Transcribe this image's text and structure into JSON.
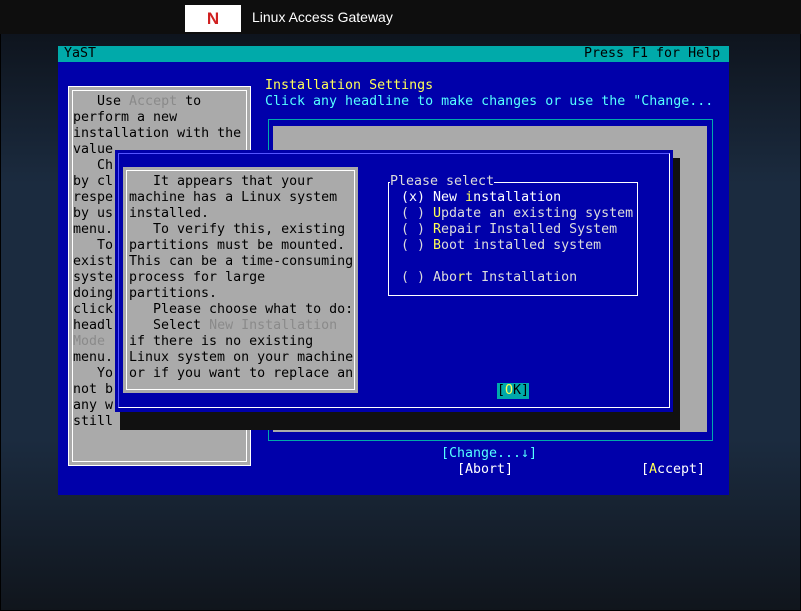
{
  "topbar": {
    "logo_letter": "N",
    "title": "Linux Access Gateway"
  },
  "yast": {
    "title": "YaST",
    "help_hint": "Press F1 for Help"
  },
  "main": {
    "heading": "Installation Settings",
    "subheading": "Click any headline to make changes or use the \"Change..."
  },
  "help": {
    "lines": [
      [
        "   Use ",
        "Accept",
        " to"
      ],
      [
        "perform a new",
        "",
        ""
      ],
      [
        "installation with the",
        "",
        ""
      ],
      [
        "value",
        "",
        ""
      ],
      [
        "   Ch",
        "",
        ""
      ],
      [
        "by cl",
        "",
        ""
      ],
      [
        "respe",
        "",
        ""
      ],
      [
        "by us",
        "",
        ""
      ],
      [
        "menu.",
        "",
        ""
      ],
      [
        "   To",
        "",
        ""
      ],
      [
        "exist",
        "",
        ""
      ],
      [
        "syste",
        "",
        ""
      ],
      [
        "doing",
        "",
        ""
      ],
      [
        "click",
        "",
        ""
      ],
      [
        "headl",
        "",
        ""
      ],
      [
        "",
        "Mode",
        ""
      ],
      [
        "menu.",
        "",
        ""
      ],
      [
        "   Yo",
        "",
        ""
      ],
      [
        "not b",
        "",
        ""
      ],
      [
        "any w",
        "",
        ""
      ],
      [
        "still",
        "",
        ""
      ]
    ]
  },
  "dialog": {
    "explanation": [
      [
        "   It appears that your",
        "",
        ""
      ],
      [
        "machine has a Linux system",
        "",
        ""
      ],
      [
        "installed.",
        "",
        ""
      ],
      [
        "   To verify this, existing",
        "",
        ""
      ],
      [
        "partitions must be mounted.",
        "",
        ""
      ],
      [
        "This can be a time-consuming",
        "",
        ""
      ],
      [
        "process for large",
        "",
        ""
      ],
      [
        "partitions.",
        "",
        ""
      ],
      [
        "   Please choose what to do:",
        "",
        ""
      ],
      [
        "   Select ",
        "New Installation",
        ""
      ],
      [
        "if there is no existing",
        "",
        ""
      ],
      [
        "Linux system on your machine",
        "",
        ""
      ],
      [
        "or if you want to replace an",
        "",
        ""
      ]
    ],
    "frame_title": "Please select",
    "options": [
      {
        "mark": "(x)",
        "pre": "New ",
        "hot": "i",
        "post": "nstallation",
        "selected": true
      },
      {
        "mark": "( )",
        "pre": "",
        "hot": "U",
        "post": "pdate an existing system",
        "selected": false
      },
      {
        "mark": "( )",
        "pre": "",
        "hot": "R",
        "post": "epair Installed System",
        "selected": false
      },
      {
        "mark": "( )",
        "pre": "",
        "hot": "B",
        "post": "oot installed system",
        "selected": false
      },
      {
        "mark": "( )",
        "pre": "Abo",
        "hot": "r",
        "post": "t Installation",
        "selected": false
      }
    ],
    "ok": {
      "open": "[",
      "hot": "O",
      "rest": "K]"
    }
  },
  "footer": {
    "change": "[Change...↓]",
    "abort": "[Abort]",
    "accept_open": "[",
    "accept_hot": "A",
    "accept_rest": "ccept]"
  },
  "colors": {
    "console_blue": "#0000aa",
    "cyan": "#00aaaa",
    "gray_panel": "#aaaaaa",
    "hotkey_yellow": "#ffff55"
  }
}
